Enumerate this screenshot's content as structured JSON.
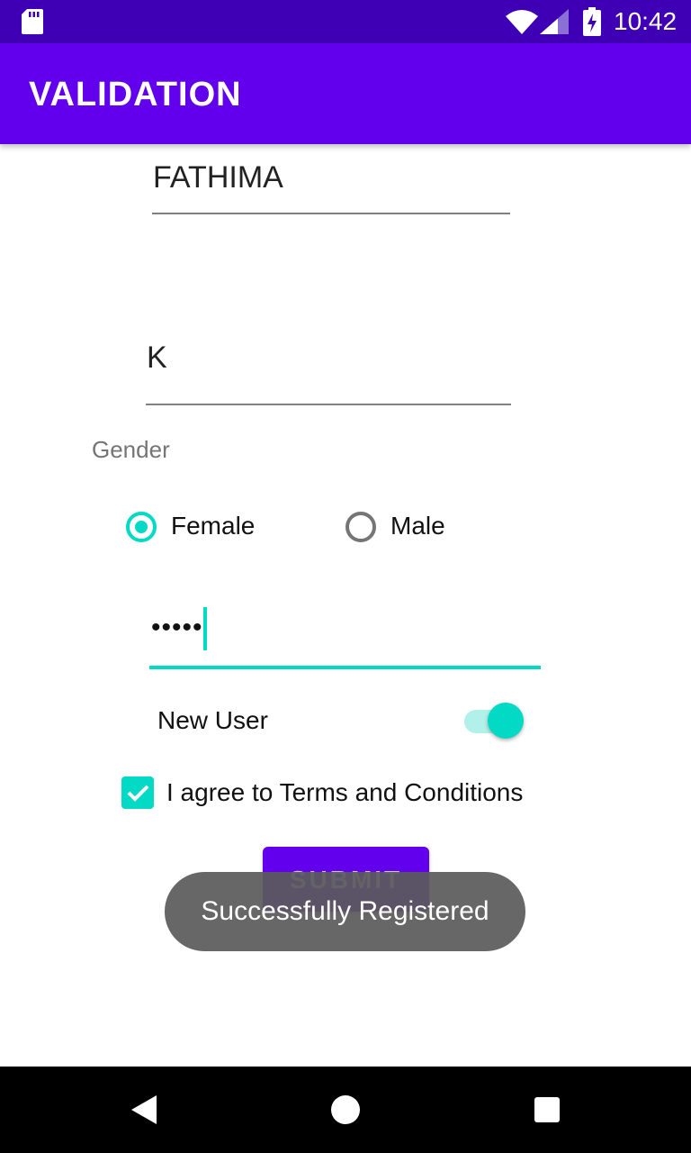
{
  "status_bar": {
    "time": "10:42",
    "icons": [
      "sd-card-icon",
      "wifi-icon",
      "signal-icon",
      "battery-charging-icon"
    ]
  },
  "app_bar": {
    "title": "VALIDATION"
  },
  "form": {
    "first_name": "FATHIMA",
    "last_name": "K",
    "gender_label": "Gender",
    "gender_options": [
      {
        "label": "Female",
        "selected": true
      },
      {
        "label": "Male",
        "selected": false
      }
    ],
    "password_mask": "•••••",
    "new_user_label": "New User",
    "new_user_on": true,
    "terms_label": "I agree to Terms and Conditions",
    "terms_checked": true,
    "submit_label": "SUBMIT"
  },
  "toast": {
    "message": "Successfully Registered"
  },
  "colors": {
    "primary": "#6200ee",
    "primary_dark": "#3f00b5",
    "accent": "#03dac5"
  },
  "nav_bar": {
    "icons": [
      "back-icon",
      "home-icon",
      "recents-icon"
    ]
  }
}
